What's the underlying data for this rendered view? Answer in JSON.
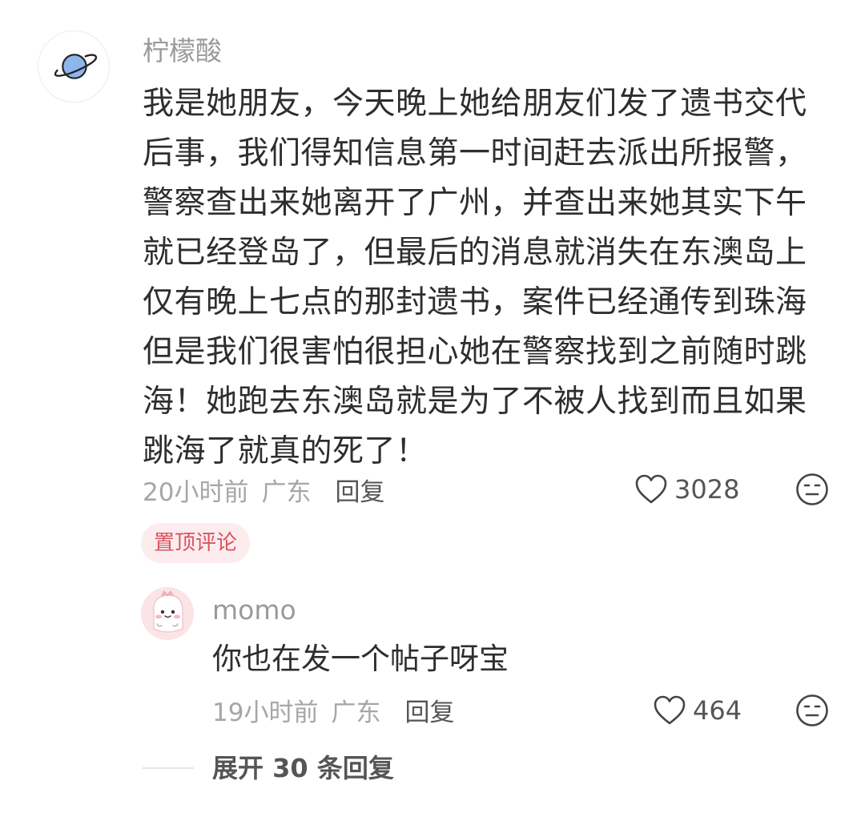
{
  "comment": {
    "author": "柠檬酸",
    "body": "我是她朋友，今天晚上她给朋友们发了遗书交代后事，我们得知信息第一时间赶去派出所报警，警察查出来她离开了广州，并查出来她其实下午就已经登岛了，但最后的消息就消失在东澳岛上仅有晚上七点的那封遗书，案件已经通传到珠海但是我们很害怕很担心她在警察找到之前随时跳海！她跑去东澳岛就是为了不被人找到而且如果跳海了就真的死了！",
    "time": "20小时前",
    "location": "广东",
    "reply_label": "回复",
    "likes": "3028",
    "pinned_label": "置顶评论",
    "avatar_icon": "planet-icon",
    "like_icon": "heart-icon",
    "dislike_icon": "meh-face-icon"
  },
  "reply": {
    "author": "momo",
    "body": "你也在发一个帖子呀宝",
    "time": "19小时前",
    "location": "广东",
    "reply_label": "回复",
    "likes": "464",
    "avatar_icon": "pink-dino-avatar",
    "like_icon": "heart-icon",
    "dislike_icon": "meh-face-icon"
  },
  "expand": {
    "label": "展开 30 条回复"
  },
  "colors": {
    "pinned_text": "#d8545f",
    "pinned_bg": "#fdecee",
    "meta_text": "#a6a6a6",
    "body_text": "#2e2e2e"
  }
}
